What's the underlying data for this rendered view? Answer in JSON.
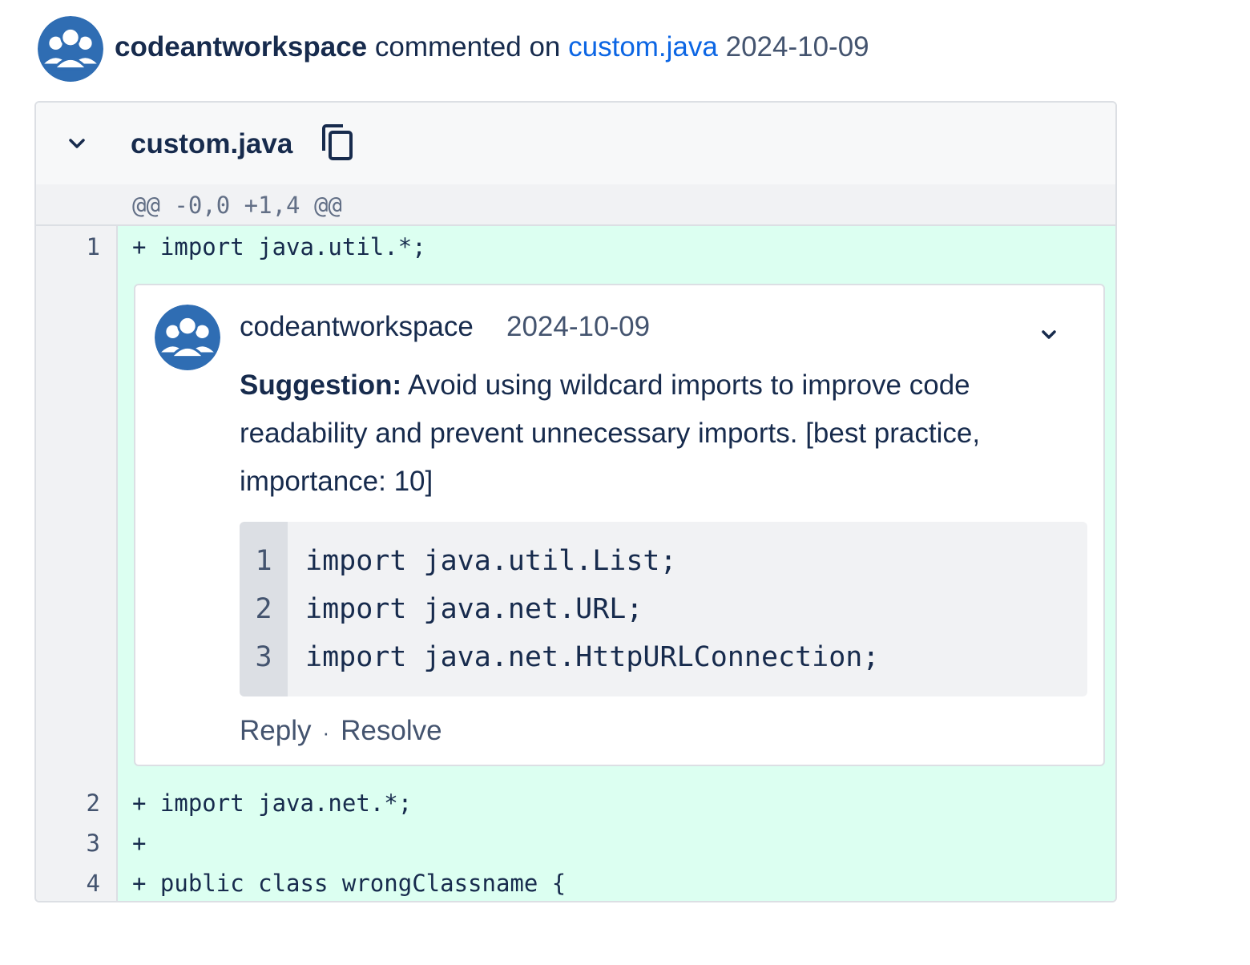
{
  "activity": {
    "author": "codeantworkspace",
    "verb": "commented on",
    "file_link": "custom.java",
    "date": "2024-10-09"
  },
  "file": {
    "name": "custom.java",
    "hunk_header": "@@ -0,0 +1,4 @@",
    "lines": [
      {
        "num": "1",
        "text": "+ import java.util.*;"
      },
      {
        "num": "2",
        "text": "+ import java.net.*;"
      },
      {
        "num": "3",
        "text": "+"
      },
      {
        "num": "4",
        "text": "+ public class wrongClassname {"
      }
    ]
  },
  "comment": {
    "author": "codeantworkspace",
    "date": "2024-10-09",
    "label": "Suggestion:",
    "body": " Avoid using wildcard imports to improve code readability and prevent unnecessary imports. [best practice, importance: 10]",
    "snippet": [
      {
        "num": "1",
        "code": "import java.util.List;"
      },
      {
        "num": "2",
        "code": "import java.net.URL;"
      },
      {
        "num": "3",
        "code": "import java.net.HttpURLConnection;"
      }
    ],
    "reply_label": "Reply",
    "separator": "·",
    "resolve_label": "Resolve"
  },
  "colors": {
    "avatar": "#2f6db3",
    "link": "#0c66e4",
    "added_bg": "#dcfff1"
  }
}
